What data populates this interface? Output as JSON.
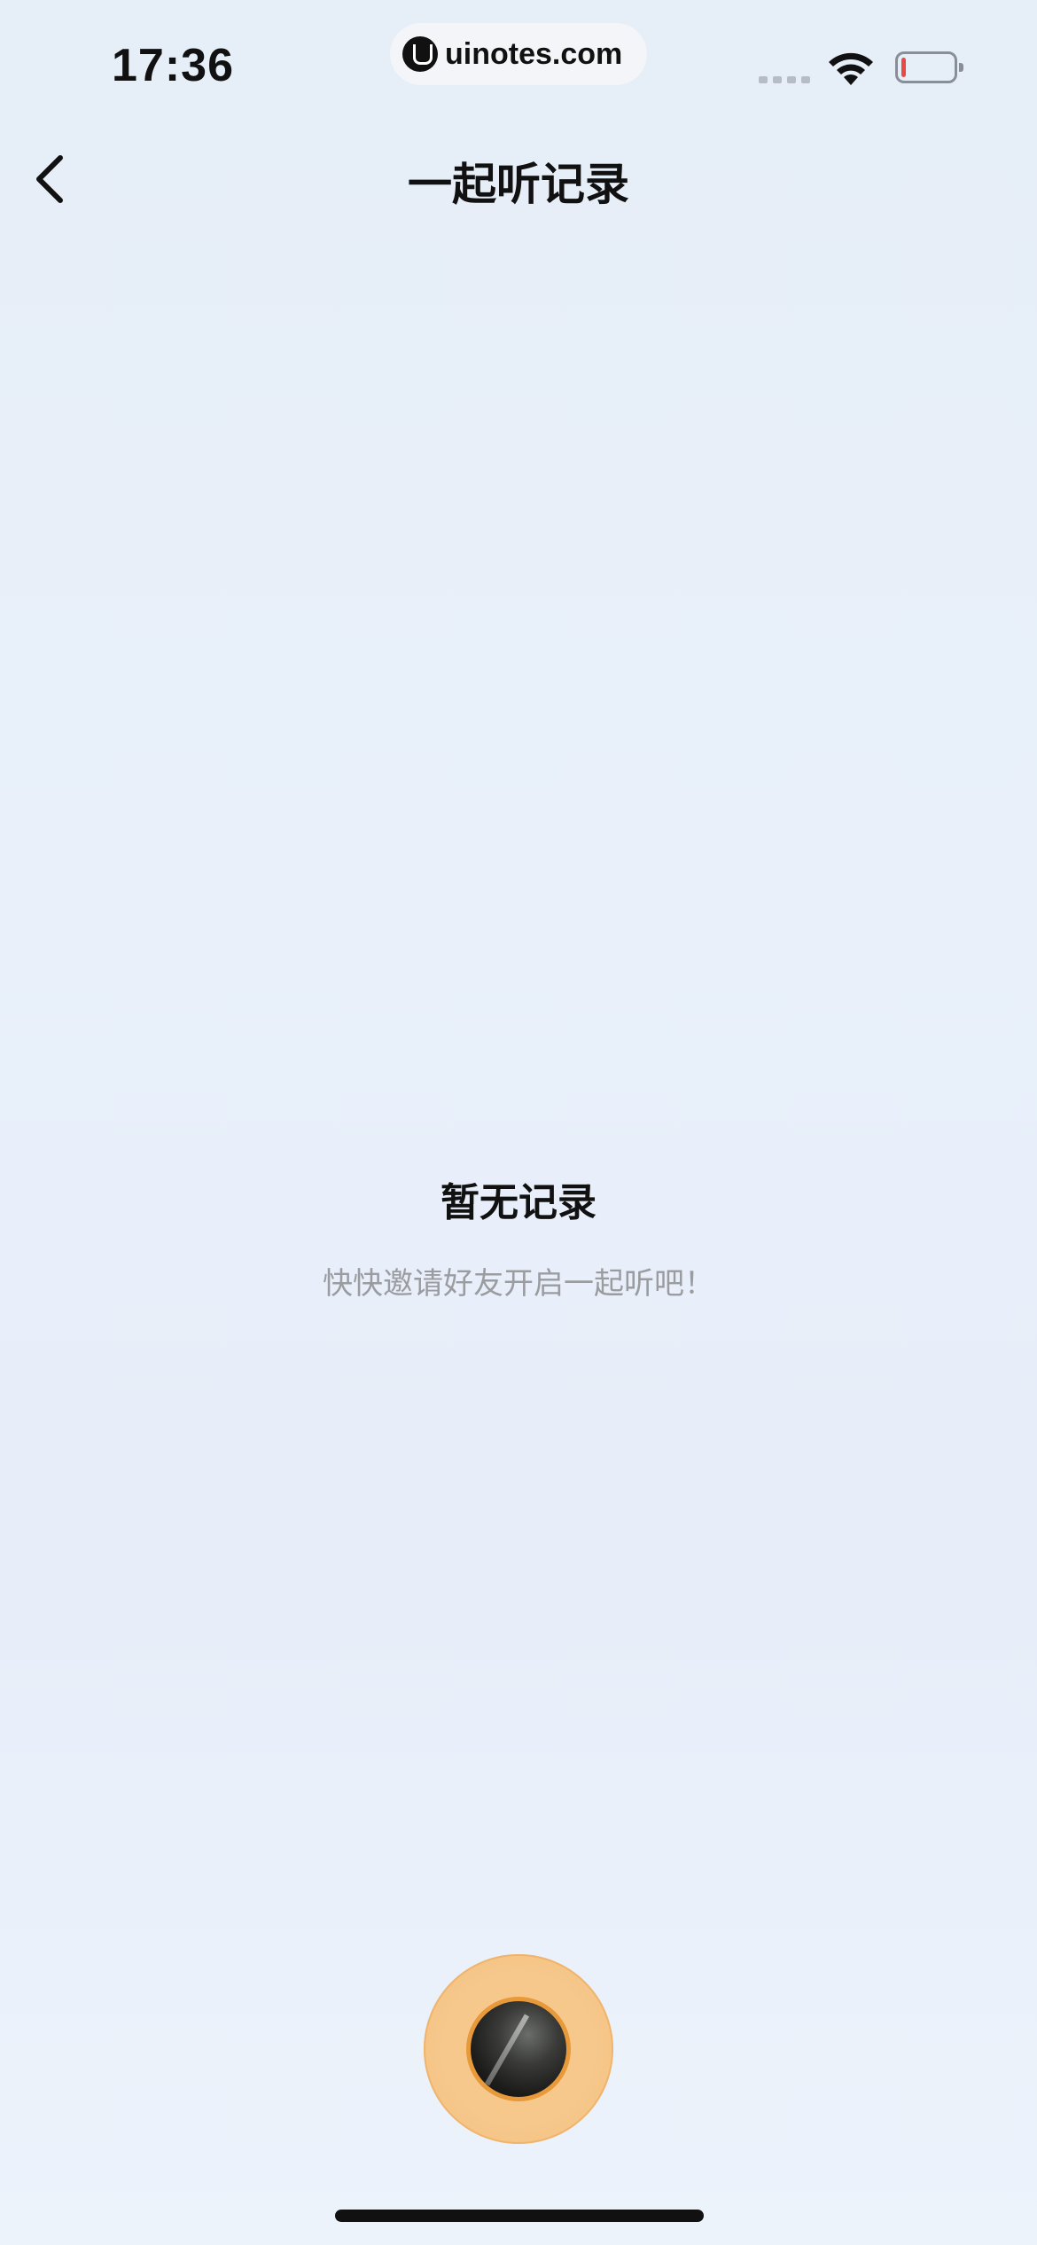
{
  "status_bar": {
    "time": "17:36",
    "watermark": "uinotes.com",
    "battery_level_percent": 8
  },
  "nav": {
    "title": "一起听记录"
  },
  "empty_state": {
    "title": "暂无记录",
    "subtitle": "快快邀请好友开启一起听吧！"
  },
  "colors": {
    "accent_battery_low": "#e84b45",
    "disc_orange": "#f6c88c",
    "subtitle_gray": "#9a9ca0"
  },
  "icons": {
    "back": "chevron-left-icon",
    "wifi": "wifi-icon",
    "battery": "battery-icon",
    "signal": "cellular-signal-icon",
    "watermark_logo": "uinotes-logo-icon"
  }
}
